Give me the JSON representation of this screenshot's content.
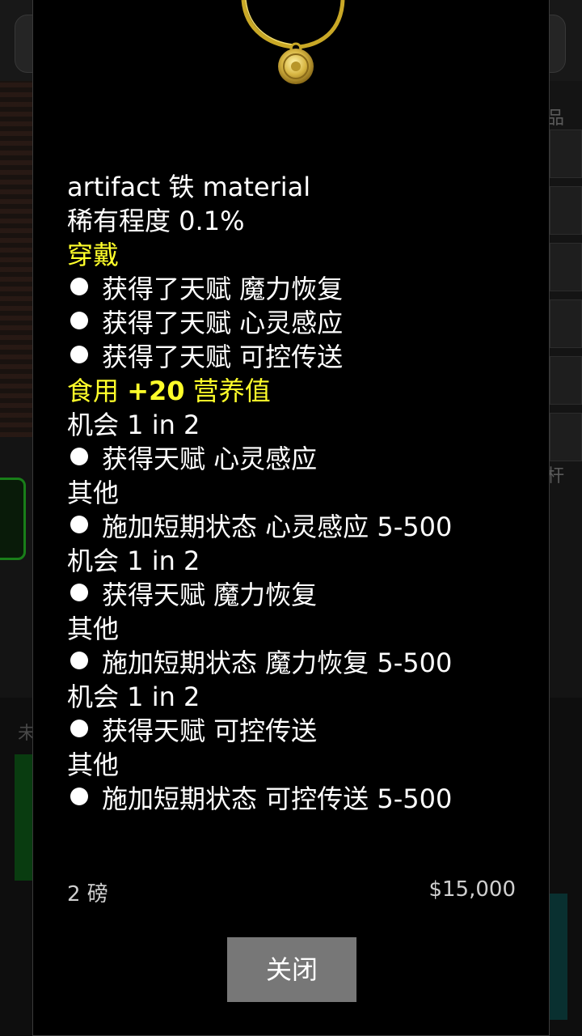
{
  "item": {
    "name": "artifact 铁 material",
    "rarity": "稀有程度 0.1%"
  },
  "wear": {
    "heading": "穿戴",
    "effects": [
      "获得了天赋 魔力恢复",
      "获得了天赋 心灵感应",
      "获得了天赋 可控传送"
    ]
  },
  "consume": {
    "heading_prefix": "食用 ",
    "heading_value": "+20",
    "heading_suffix": " 营养值",
    "groups": [
      {
        "chance": "机会 1 in 2",
        "success": "获得天赋 心灵感应",
        "else": "其他",
        "fallback": "施加短期状态 心灵感应 5-500"
      },
      {
        "chance": "机会 1 in 2",
        "success": "获得天赋 魔力恢复",
        "else": "其他",
        "fallback": "施加短期状态 魔力恢复 5-500"
      },
      {
        "chance": "机会 1 in 2",
        "success": "获得天赋 可控传送",
        "else": "其他",
        "fallback": "施加短期状态 可控传送 5-500"
      }
    ]
  },
  "footer": {
    "weight": "2 磅",
    "price": "$15,000"
  },
  "close_label": "关闭",
  "background": {
    "right_text_1": "品",
    "right_text_2": "杆",
    "left_text": "未"
  },
  "colors": {
    "accent_yellow": "#ffff2a",
    "modal_bg": "#000000",
    "button_bg": "#777777"
  },
  "icons": {
    "pendant": "gold-amulet-icon",
    "bullet": "bullet-dot-icon"
  }
}
